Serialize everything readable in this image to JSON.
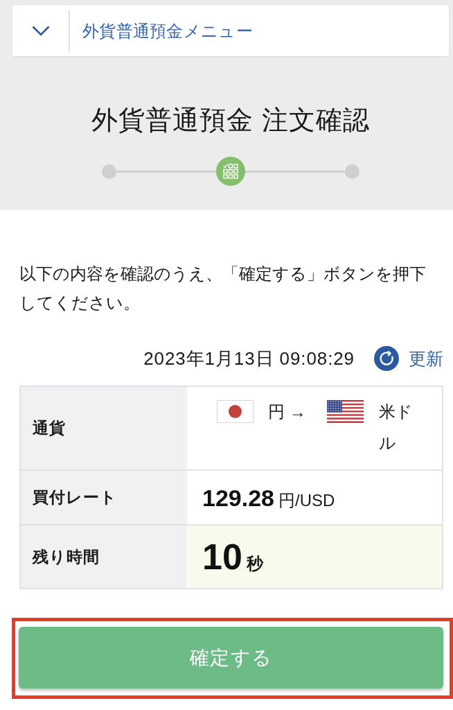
{
  "menu": {
    "label": "外貨普通預金メニュー",
    "expanded": false
  },
  "title": "外貨普通預金 注文確認",
  "steps": [
    {
      "selected": false
    },
    {
      "selected": true
    },
    {
      "selected": false
    }
  ],
  "instruction": "以下の内容を確認のうえ、「確定する」ボタンを押下してください。",
  "timestamp": "2023年1月13日 09:08:29",
  "refresh": {
    "label": "更新"
  },
  "table": {
    "rows": [
      {
        "kind": "currency",
        "label": "通貨",
        "from_currency": "円 →",
        "to_currency": "米ドル"
      },
      {
        "kind": "rate",
        "label": "買付レート",
        "value": "129.28",
        "unit": "円/USD"
      },
      {
        "kind": "timer",
        "label": "残り時間",
        "value": "10",
        "unit": "秒"
      }
    ]
  },
  "confirm": {
    "label": "確定する",
    "highlighted": true
  }
}
